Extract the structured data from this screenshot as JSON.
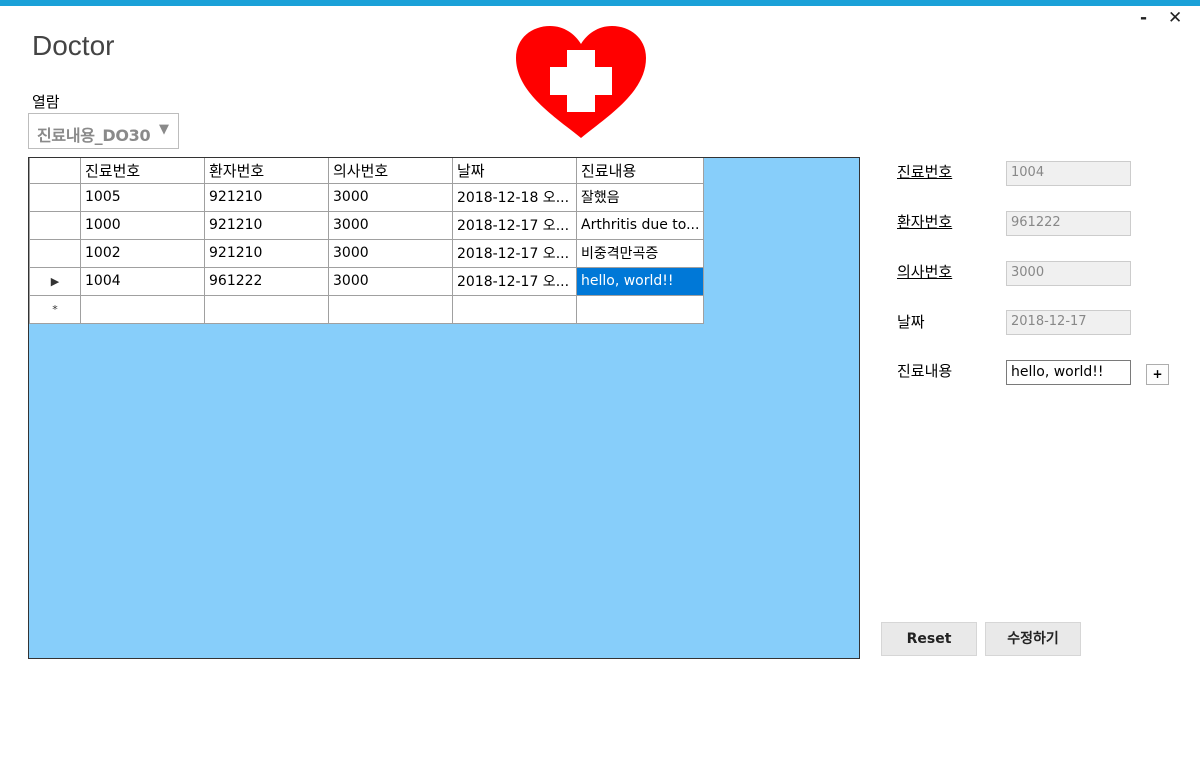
{
  "window": {
    "title": "Doctor",
    "minimize_label": "-",
    "close_label": "✕"
  },
  "browse": {
    "label": "열람",
    "combo_value": "진료내용_DO30"
  },
  "grid": {
    "columns": [
      "진료번호",
      "환자번호",
      "의사번호",
      "날짜",
      "진료내용"
    ],
    "rows": [
      {
        "indicator": "",
        "cells": [
          "1005",
          "921210",
          "3000",
          "2018-12-18 오...",
          "잘했음"
        ]
      },
      {
        "indicator": "",
        "cells": [
          "1000",
          "921210",
          "3000",
          "2018-12-17 오...",
          "Arthritis due to..."
        ]
      },
      {
        "indicator": "",
        "cells": [
          "1002",
          "921210",
          "3000",
          "2018-12-17 오...",
          "비중격만곡증"
        ]
      },
      {
        "indicator": "▶",
        "cells": [
          "1004",
          "961222",
          "3000",
          "2018-12-17 오...",
          "hello, world!!"
        ]
      },
      {
        "indicator": "*",
        "cells": [
          "",
          "",
          "",
          "",
          ""
        ]
      }
    ],
    "background": "#87cefa",
    "selection_color": "#0078d7"
  },
  "form": {
    "treatment_no": {
      "label": "진료번호",
      "value": "1004"
    },
    "patient_no": {
      "label": "환자번호",
      "value": "961222"
    },
    "doctor_no": {
      "label": "의사번호",
      "value": "3000"
    },
    "date": {
      "label": "날짜",
      "value": "2018-12-17"
    },
    "content": {
      "label": "진료내용",
      "value": "hello, world!!"
    },
    "plus_label": "+"
  },
  "buttons": {
    "reset": "Reset",
    "edit": "수정하기"
  },
  "colors": {
    "accent": "#1aa1d8",
    "heart": "#ff0000"
  }
}
